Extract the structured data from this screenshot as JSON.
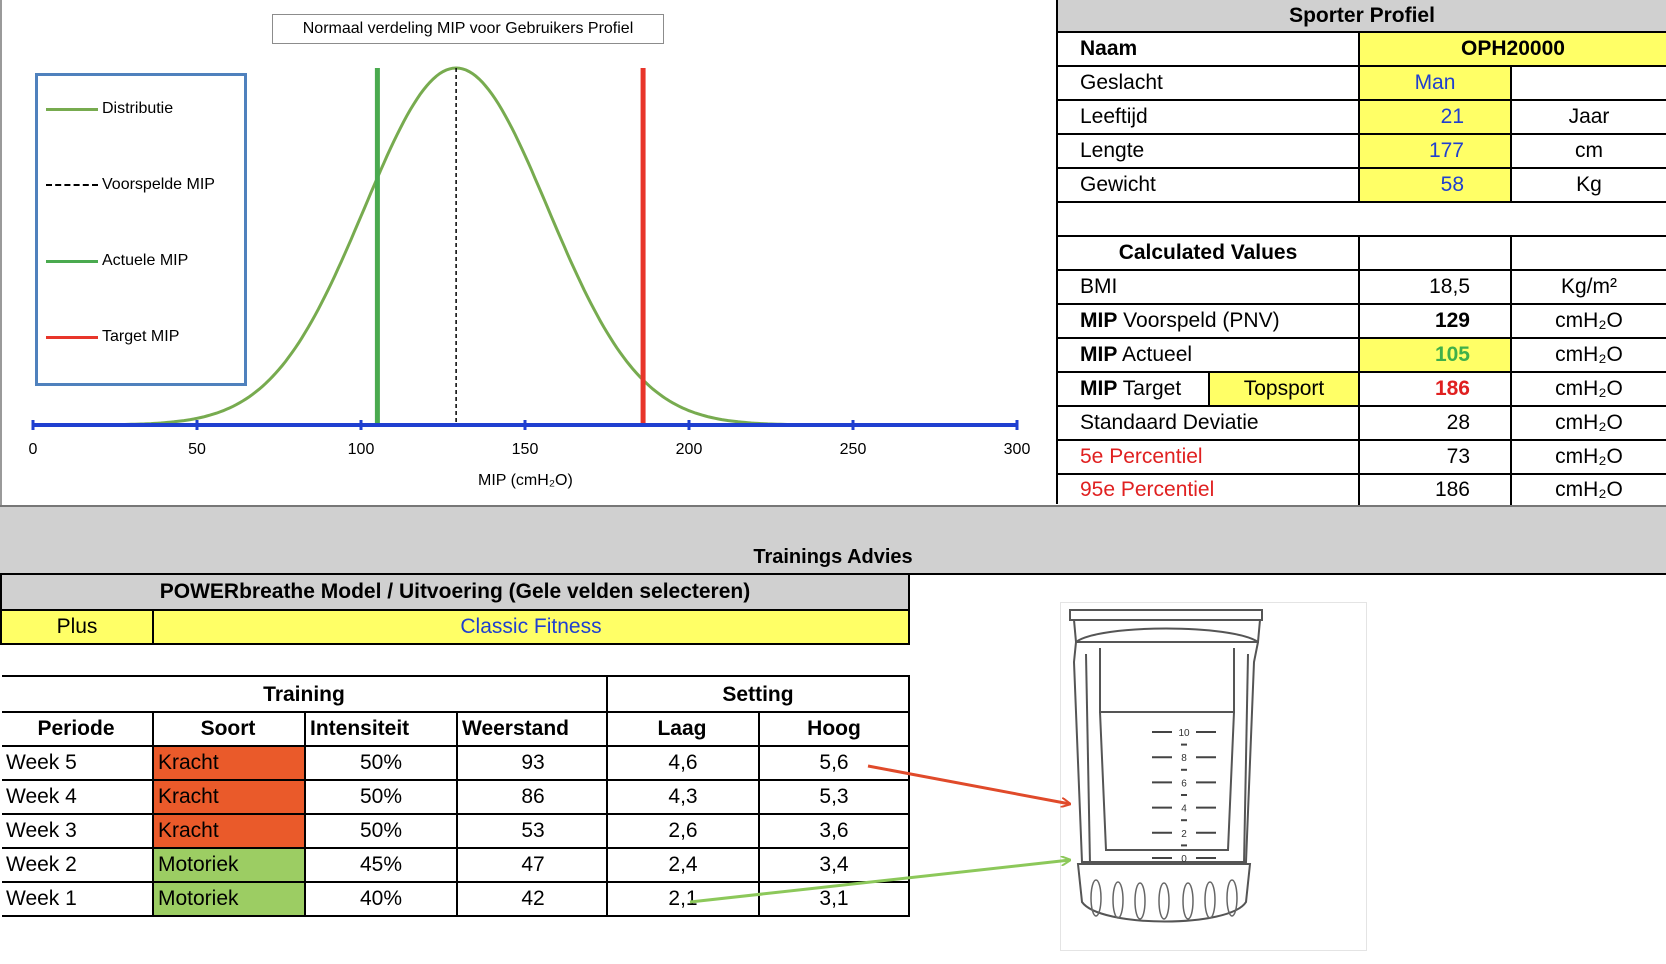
{
  "chart_data": {
    "type": "line",
    "title": "Normaal verdeling MIP voor Gebruikers Profiel",
    "xlabel": "MIP (cmH₂O)",
    "ylabel": "",
    "xlim": [
      0,
      300
    ],
    "xticks": [
      "0",
      "50",
      "100",
      "150",
      "200",
      "250",
      "300"
    ],
    "legend_position": "left",
    "series": [
      {
        "name": "Distributie",
        "type": "normal-curve",
        "mean": 129,
        "sd": 28,
        "color": "#77ab4f"
      },
      {
        "name": "Voorspelde MIP",
        "type": "vline",
        "x": 129,
        "color": "#000000",
        "dash": true
      },
      {
        "name": "Actuele MIP",
        "type": "vline",
        "x": 105,
        "color": "#4aaa4f"
      },
      {
        "name": "Target MIP",
        "type": "vline",
        "x": 186,
        "color": "#e8352a"
      }
    ],
    "axis_color": "#1f3fd0"
  },
  "profile": {
    "header": "Sporter Profiel",
    "naam_label": "Naam",
    "naam_value": "OPH20000",
    "geslacht_label": "Geslacht",
    "geslacht_value": "Man",
    "leeftijd_label": "Leeftijd",
    "leeftijd_value": "21",
    "leeftijd_unit": "Jaar",
    "lengte_label": "Lengte",
    "lengte_value": "177",
    "lengte_unit": "cm",
    "gewicht_label": "Gewicht",
    "gewicht_value": "58",
    "gewicht_unit": "Kg"
  },
  "calculated": {
    "header": "Calculated Values",
    "bmi_label": "BMI",
    "bmi_value": "18,5",
    "bmi_unit": "Kg/m²",
    "mip_voorspeld_bold": "MIP",
    "mip_voorspeld_label": " Voorspeld (PNV)",
    "mip_voorspeld_value": "129",
    "mip_voorspeld_unit": "cmH₂O",
    "mip_actueel_bold": "MIP",
    "mip_actueel_label": " Actueel",
    "mip_actueel_value": "105",
    "mip_actueel_unit": "cmH₂O",
    "mip_target_bold": "MIP",
    "mip_target_label": " Target",
    "mip_target_level": "Topsport",
    "mip_target_value": "186",
    "mip_target_unit": "cmH₂O",
    "sd_label": "Standaard Deviatie",
    "sd_value": "28",
    "sd_unit": "cmH₂O",
    "p5_label": "5e Percentiel",
    "p5_value": "73",
    "p5_unit": "cmH₂O",
    "p95_label": "95e Percentiel",
    "p95_value": "186",
    "p95_unit": "cmH₂O"
  },
  "advies": {
    "header": "Trainings Advies",
    "model_header": "POWERbreathe Model / Uitvoering (Gele velden selecteren)",
    "model": "Plus",
    "uitvoering": "Classic Fitness"
  },
  "training": {
    "group_training": "Training",
    "group_setting": "Setting",
    "columns": [
      "Periode",
      "Soort",
      "Intensiteit",
      "Weerstand",
      "Laag",
      "Hoog"
    ],
    "rows": [
      {
        "periode": "Week 5",
        "soort": "Kracht",
        "intensiteit": "50%",
        "weerstand": "93",
        "laag": "4,6",
        "hoog": "5,6"
      },
      {
        "periode": "Week 4",
        "soort": "Kracht",
        "intensiteit": "50%",
        "weerstand": "86",
        "laag": "4,3",
        "hoog": "5,3"
      },
      {
        "periode": "Week 3",
        "soort": "Kracht",
        "intensiteit": "50%",
        "weerstand": "53",
        "laag": "2,6",
        "hoog": "3,6"
      },
      {
        "periode": "Week 2",
        "soort": "Motoriek",
        "intensiteit": "45%",
        "weerstand": "47",
        "laag": "2,4",
        "hoog": "3,4"
      },
      {
        "periode": "Week 1",
        "soort": "Motoriek",
        "intensiteit": "40%",
        "weerstand": "42",
        "laag": "2,1",
        "hoog": "3,1"
      }
    ]
  },
  "device": {
    "scale_labels": [
      "10",
      "8",
      "6",
      "4",
      "2",
      "0"
    ]
  }
}
